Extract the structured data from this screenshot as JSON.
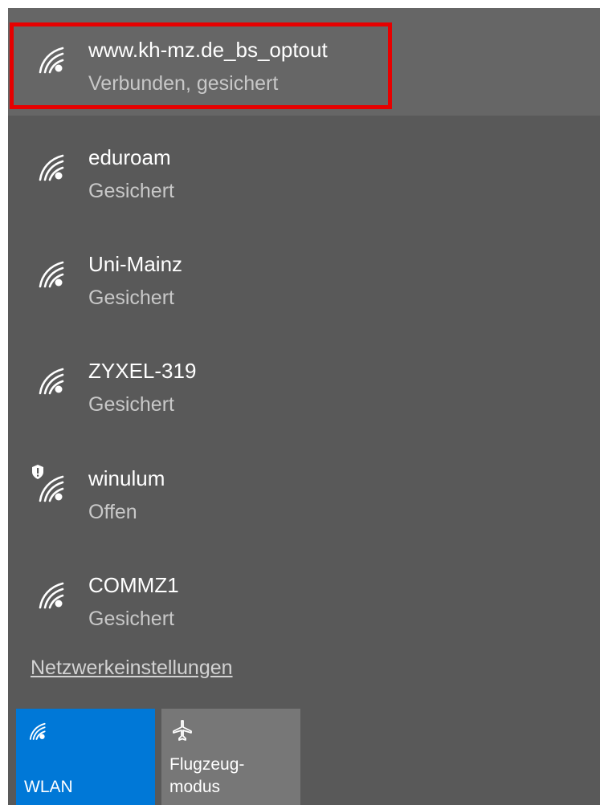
{
  "networks": [
    {
      "name": "www.kh-mz.de_bs_optout",
      "status": "Verbunden, gesichert",
      "icon": "wifi-icon",
      "connected": true,
      "open": false
    },
    {
      "name": "eduroam",
      "status": "Gesichert",
      "icon": "wifi-icon",
      "connected": false,
      "open": false
    },
    {
      "name": "Uni-Mainz",
      "status": "Gesichert",
      "icon": "wifi-icon",
      "connected": false,
      "open": false
    },
    {
      "name": "ZYXEL-319",
      "status": "Gesichert",
      "icon": "wifi-icon",
      "connected": false,
      "open": false
    },
    {
      "name": "winulum",
      "status": "Offen",
      "icon": "wifi-shield-icon",
      "connected": false,
      "open": true
    },
    {
      "name": "COMMZ1",
      "status": "Gesichert",
      "icon": "wifi-icon",
      "connected": false,
      "open": false
    }
  ],
  "settings_link": "Netzwerkeinstellungen",
  "tiles": {
    "wlan": {
      "label": "WLAN",
      "icon": "wifi-icon",
      "active": true
    },
    "airplane": {
      "label_line1": "Flugzeug-",
      "label_line2": "modus",
      "icon": "airplane-icon",
      "active": false
    }
  },
  "colors": {
    "panel_bg": "#595959",
    "connected_bg": "#666666",
    "highlight": "#e60000",
    "accent": "#0078d7",
    "tile_inactive": "#777777"
  }
}
